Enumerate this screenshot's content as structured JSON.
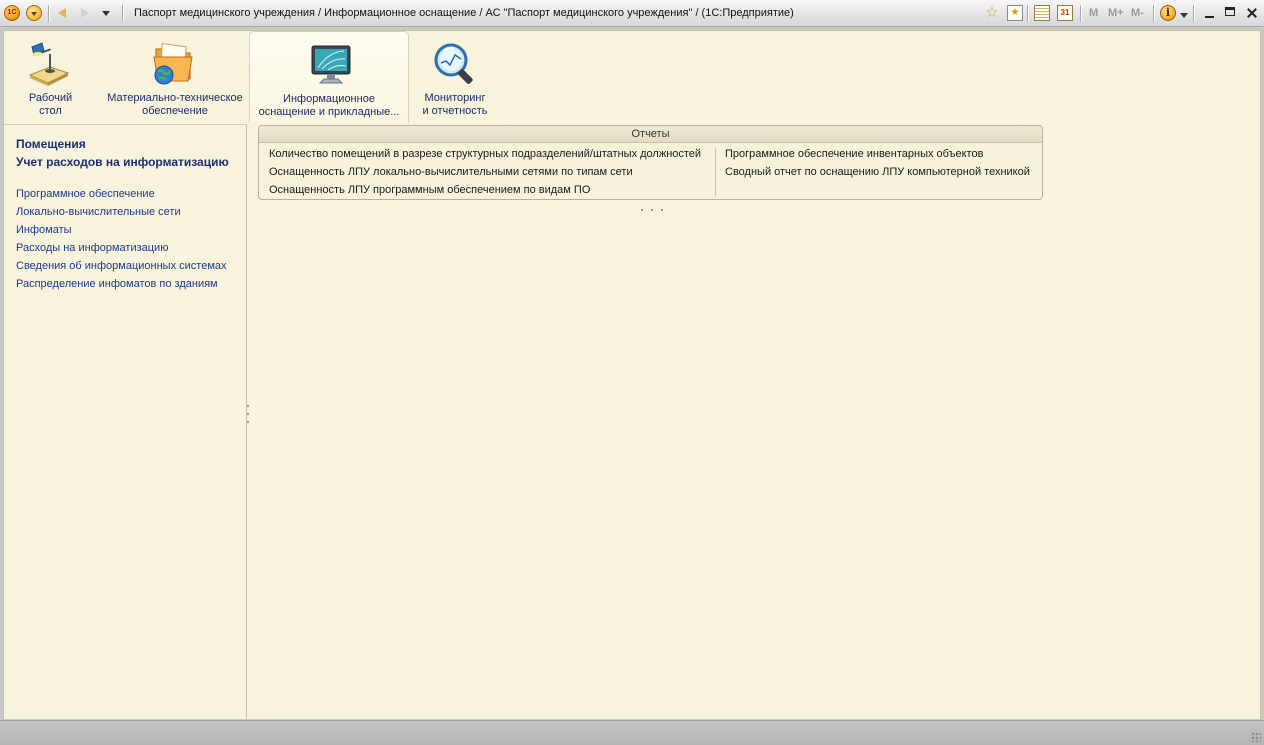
{
  "window": {
    "title": "Паспорт медицинского учреждения / Информационное оснащение / АС \"Паспорт медицинского учреждения\" /  (1С:Предприятие)",
    "logo_text": "1С",
    "calendar_day": "31",
    "memory_buttons": [
      "M",
      "M+",
      "M-"
    ],
    "info_glyph": "i"
  },
  "icons": {
    "logo": "1c-logo-icon",
    "main_menu": "main-menu-icon",
    "back": "back-arrow-icon",
    "forward": "forward-arrow-icon",
    "history": "history-dropdown-icon",
    "favorites_add": "add-to-favorites-icon",
    "favorites": "favorites-icon",
    "calculator": "calculator-icon",
    "calendar": "calendar-icon",
    "info": "info-icon",
    "minimize": "minimize-icon",
    "maximize": "maximize-icon",
    "close": "close-icon"
  },
  "sections": [
    {
      "label": "Рабочий\nстол",
      "icon": "desk-lamp-icon",
      "active": false
    },
    {
      "label": "Материально-техническое\nобеспечение",
      "icon": "folder-globe-icon",
      "active": false
    },
    {
      "label": "Информационное\nоснащение и прикладные...",
      "icon": "monitor-icon",
      "active": true
    },
    {
      "label": "Мониторинг\nи отчетность",
      "icon": "magnifier-icon",
      "active": false
    }
  ],
  "left_panel": {
    "bold_items": [
      "Помещения",
      "Учет расходов на информатизацию"
    ],
    "links": [
      "Программное обеспечение",
      "Локально-вычислительные сети",
      "Инфоматы",
      "Расходы на информатизацию",
      "Сведения об информационных системах",
      "Распределение инфоматов по зданиям"
    ]
  },
  "reports_group": {
    "title": "Отчеты",
    "left_column": [
      "Количество помещений в разрезе структурных подразделений/штатных должностей",
      "Оснащенность ЛПУ локально-вычислительными сетями по типам сети",
      "Оснащенность ЛПУ программным обеспечением по видам ПО"
    ],
    "right_column": [
      "Программное обеспечение инвентарных объектов",
      "Сводный отчет по оснащению ЛПУ компьютерной техникой"
    ]
  },
  "colors": {
    "workspace_bg": "#f8f3dc",
    "bold_link": "#1b2f70",
    "link": "#1d3a8a",
    "status_bar": "#bdbdbd"
  }
}
